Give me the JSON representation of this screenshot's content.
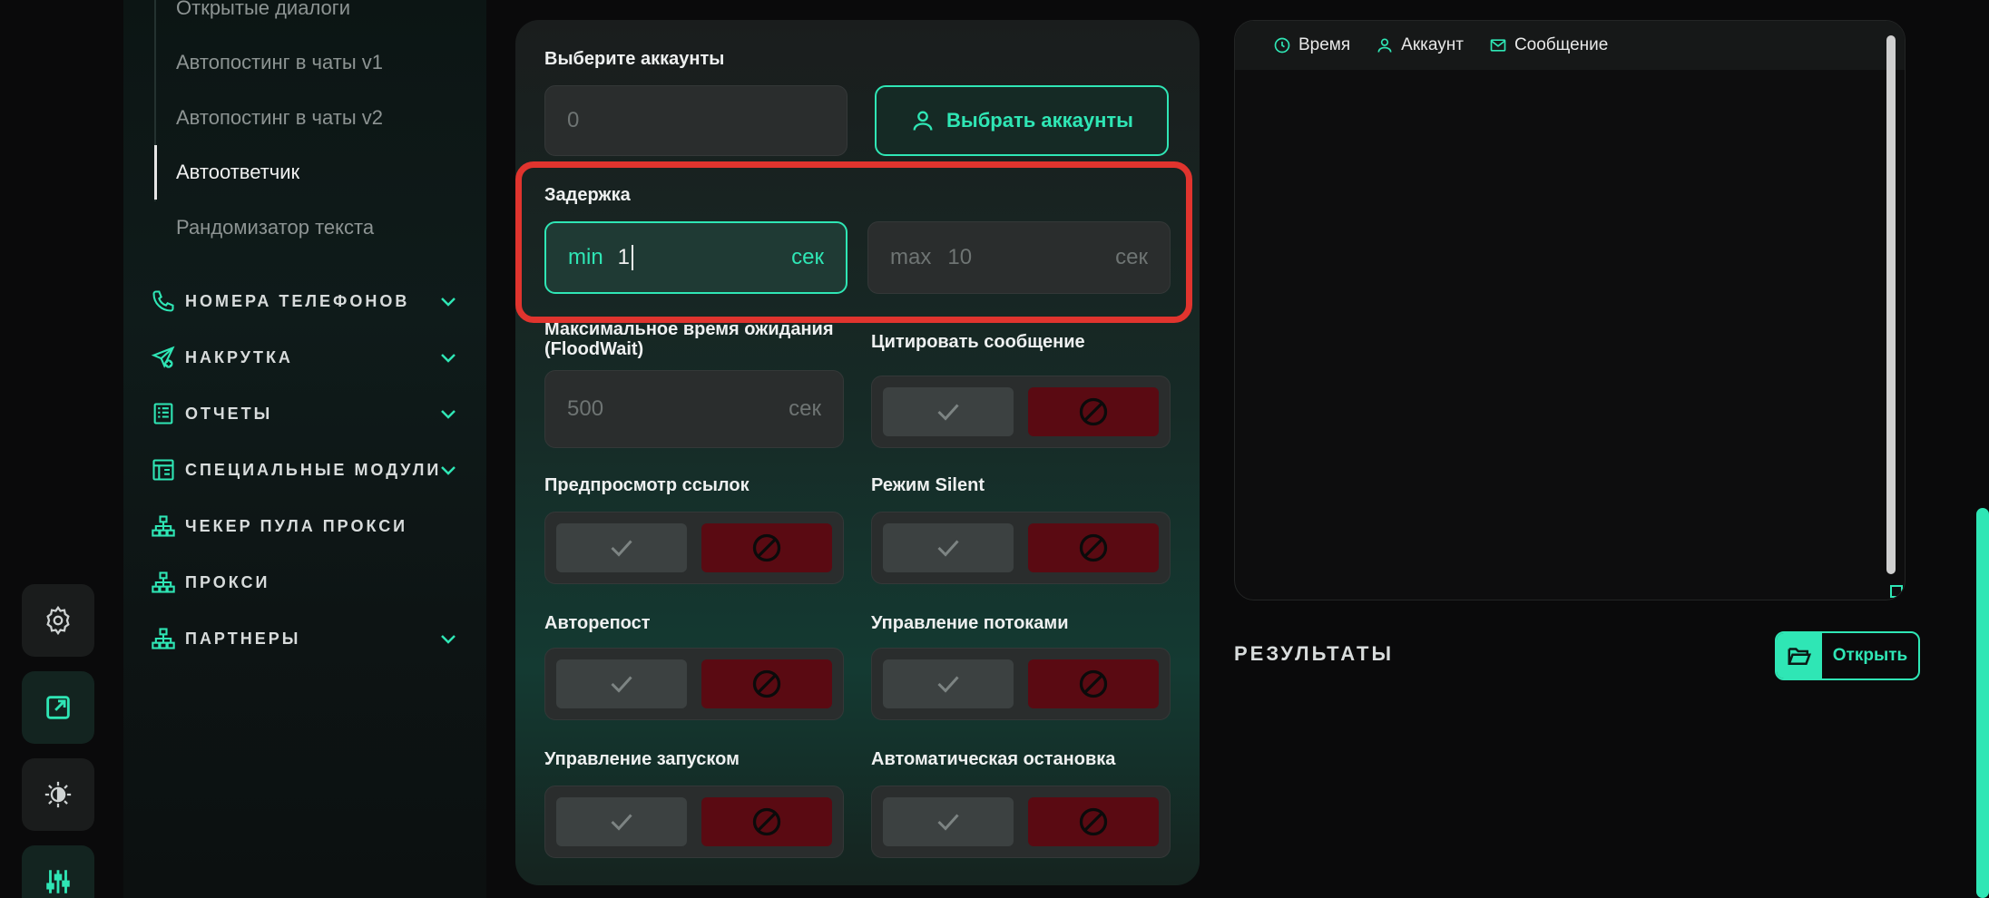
{
  "sidebar": {
    "sub_items": [
      "Открытые диалоги",
      "Автопостинг в чаты v1",
      "Автопостинг в чаты v2",
      "Автоответчик",
      "Рандомизатор текста"
    ],
    "active_sub_item": "Автоответчик",
    "nav": [
      {
        "label": "НОМЕРА ТЕЛЕФОНОВ",
        "icon": "phone-icon",
        "expandable": true
      },
      {
        "label": "НАКРУТКА",
        "icon": "send-plus-icon",
        "expandable": true
      },
      {
        "label": "ОТЧЕТЫ",
        "icon": "report-icon",
        "expandable": true
      },
      {
        "label": "СПЕЦИАЛЬНЫЕ МОДУЛИ",
        "icon": "modules-icon",
        "expandable": true
      },
      {
        "label": "ЧЕКЕР ПУЛА ПРОКСИ",
        "icon": "network-icon",
        "expandable": false
      },
      {
        "label": "ПРОКСИ",
        "icon": "network-icon",
        "expandable": false
      },
      {
        "label": "ПАРТНЕРЫ",
        "icon": "network-icon",
        "expandable": true
      }
    ]
  },
  "dock": [
    "gear-icon",
    "external-link-icon",
    "theme-icon",
    "sliders-icon"
  ],
  "form": {
    "accounts_label": "Выберите аккаунты",
    "accounts_value": "0",
    "select_accounts_button": "Выбрать аккаунты",
    "delay_label": "Задержка",
    "delay_min_prefix": "min",
    "delay_min_value": "1",
    "delay_max_prefix": "max",
    "delay_max_placeholder": "10",
    "delay_unit": "сек",
    "floodwait_label_line1": "Максимальное время ожидания",
    "floodwait_label_line2": "(FloodWait)",
    "floodwait_placeholder": "500",
    "floodwait_unit": "сек",
    "toggles": [
      {
        "label": "Цитировать сообщение",
        "state": "off"
      },
      {
        "label": "Предпросмотр ссылок",
        "state": "off"
      },
      {
        "label": "Режим Silent",
        "state": "off"
      },
      {
        "label": "Авторепост",
        "state": "off"
      },
      {
        "label": "Управление потоками",
        "state": "off"
      },
      {
        "label": "Управление запуском",
        "state": "off"
      },
      {
        "label": "Автоматическая остановка",
        "state": "off"
      }
    ]
  },
  "log": {
    "tabs": [
      {
        "label": "Время",
        "icon": "clock-icon"
      },
      {
        "label": "Аккаунт",
        "icon": "user-icon"
      },
      {
        "label": "Сообщение",
        "icon": "mail-icon"
      }
    ]
  },
  "results": {
    "title": "РЕЗУЛЬТАТЫ",
    "open_button": "Открыть"
  },
  "colors": {
    "accent": "#2fe6b5",
    "highlight": "#e0342e",
    "toggle_off": "#5a0a12"
  }
}
